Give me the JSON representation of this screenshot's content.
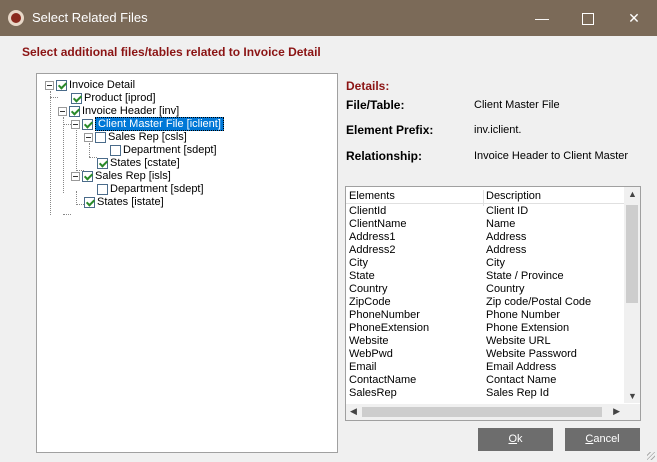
{
  "window": {
    "title": "Select Related Files",
    "minimize_glyph": "—",
    "close_glyph": "✕"
  },
  "header_label": "Select additional files/tables related to Invoice Detail",
  "tree": {
    "items": [
      {
        "label": "Invoice Detail",
        "checked": true,
        "expander": true
      },
      {
        "label": "Product [iprod]",
        "checked": true,
        "expander": false
      },
      {
        "label": "Invoice Header [inv]",
        "checked": true,
        "expander": true
      },
      {
        "label": "Client Master File [iclient]",
        "checked": true,
        "expander": true,
        "selected": true
      },
      {
        "label": "Sales Rep [csls]",
        "checked": false,
        "expander": true
      },
      {
        "label": "Department [sdept]",
        "checked": false,
        "expander": false
      },
      {
        "label": "States [cstate]",
        "checked": true,
        "expander": false
      },
      {
        "label": "Sales Rep [isls]",
        "checked": true,
        "expander": true
      },
      {
        "label": "Department [sdept]",
        "checked": false,
        "expander": false
      },
      {
        "label": "States [istate]",
        "checked": true,
        "expander": false
      }
    ]
  },
  "details": {
    "title": "Details:",
    "file_table_label": "File/Table:",
    "file_table_value": "Client Master File",
    "prefix_label": "Element Prefix:",
    "prefix_value": "inv.iclient.",
    "relationship_label": "Relationship:",
    "relationship_value": "Invoice Header to Client Master"
  },
  "grid": {
    "headers": [
      "Elements",
      "Description"
    ],
    "rows": [
      [
        "ClientId",
        "Client ID"
      ],
      [
        "ClientName",
        "Name"
      ],
      [
        "Address1",
        "Address"
      ],
      [
        "Address2",
        "Address"
      ],
      [
        "City",
        "City"
      ],
      [
        "State",
        "State / Province"
      ],
      [
        "Country",
        "Country"
      ],
      [
        "ZipCode",
        "Zip code/Postal Code"
      ],
      [
        "PhoneNumber",
        "Phone Number"
      ],
      [
        "PhoneExtension",
        "Phone Extension"
      ],
      [
        "Website",
        "Website URL"
      ],
      [
        "WebPwd",
        "Website Password"
      ],
      [
        "Email",
        "Email Address"
      ],
      [
        "ContactName",
        "Contact Name"
      ],
      [
        "SalesRep",
        "Sales Rep Id"
      ]
    ]
  },
  "buttons": {
    "ok_access": "O",
    "ok_rest": "k",
    "cancel_access": "C",
    "cancel_rest": "ancel"
  }
}
